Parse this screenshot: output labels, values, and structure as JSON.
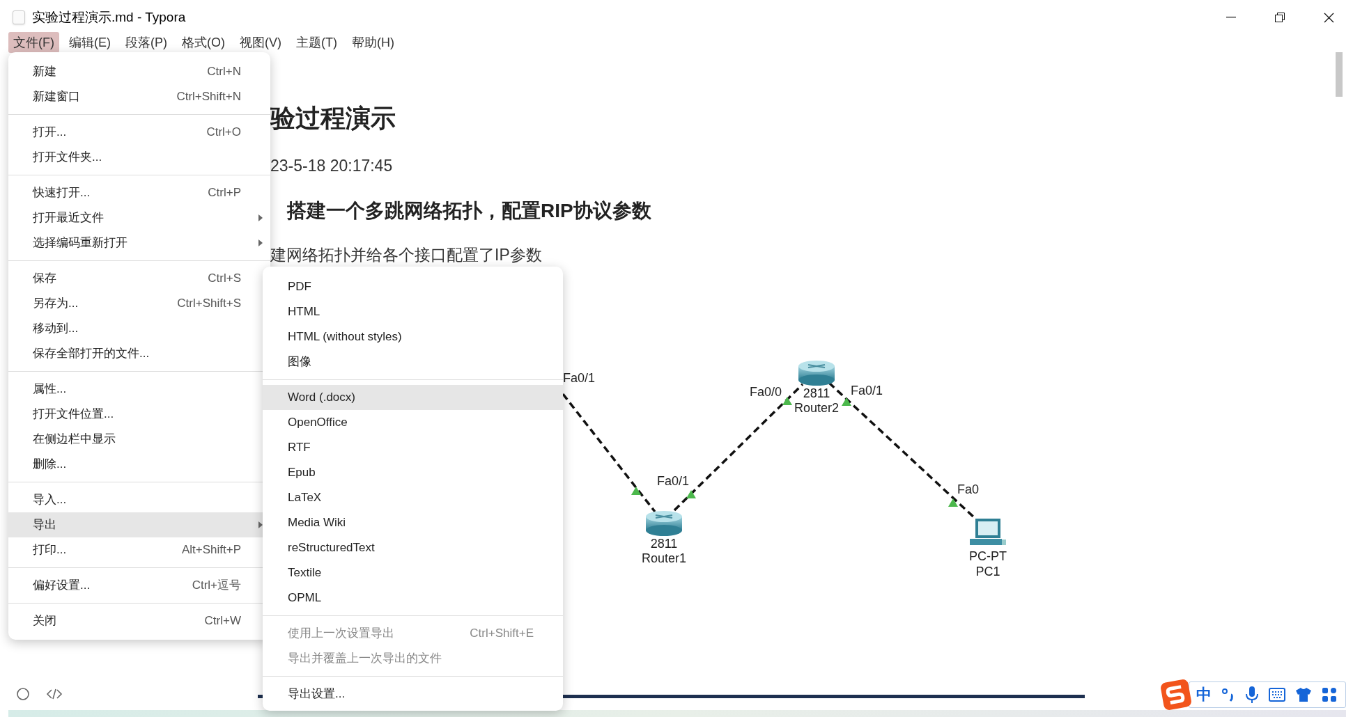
{
  "window": {
    "title": "实验过程演示.md - Typora"
  },
  "menu_bar": [
    {
      "label": "文件(F)",
      "selected": true
    },
    {
      "label": "编辑(E)",
      "selected": false
    },
    {
      "label": "段落(P)",
      "selected": false
    },
    {
      "label": "格式(O)",
      "selected": false
    },
    {
      "label": "视图(V)",
      "selected": false
    },
    {
      "label": "主题(T)",
      "selected": false
    },
    {
      "label": "帮助(H)",
      "selected": false
    }
  ],
  "file_menu": [
    [
      {
        "label": "新建",
        "shortcut": "Ctrl+N",
        "submenu": false,
        "selected": false
      },
      {
        "label": "新建窗口",
        "shortcut": "Ctrl+Shift+N",
        "submenu": false,
        "selected": false
      }
    ],
    [
      {
        "label": "打开...",
        "shortcut": "Ctrl+O",
        "submenu": false,
        "selected": false
      },
      {
        "label": "打开文件夹...",
        "submenu": false,
        "selected": false
      }
    ],
    [
      {
        "label": "快速打开...",
        "shortcut": "Ctrl+P",
        "submenu": false,
        "selected": false
      },
      {
        "label": "打开最近文件",
        "submenu": true,
        "selected": false
      },
      {
        "label": "选择编码重新打开",
        "submenu": true,
        "selected": false
      }
    ],
    [
      {
        "label": "保存",
        "shortcut": "Ctrl+S",
        "submenu": false,
        "selected": false
      },
      {
        "label": "另存为...",
        "shortcut": "Ctrl+Shift+S",
        "submenu": false,
        "selected": false
      },
      {
        "label": "移动到...",
        "submenu": false,
        "selected": false
      },
      {
        "label": "保存全部打开的文件...",
        "submenu": false,
        "selected": false
      }
    ],
    [
      {
        "label": "属性...",
        "submenu": false,
        "selected": false
      },
      {
        "label": "打开文件位置...",
        "submenu": false,
        "selected": false
      },
      {
        "label": "在侧边栏中显示",
        "submenu": false,
        "selected": false
      },
      {
        "label": "删除...",
        "submenu": false,
        "selected": false
      }
    ],
    [
      {
        "label": "导入...",
        "submenu": false,
        "selected": false
      },
      {
        "label": "导出",
        "submenu": true,
        "selected": true
      },
      {
        "label": "打印...",
        "shortcut": "Alt+Shift+P",
        "submenu": false,
        "selected": false
      }
    ],
    [
      {
        "label": "偏好设置...",
        "shortcut": "Ctrl+逗号",
        "submenu": false,
        "selected": false
      }
    ],
    [
      {
        "label": "关闭",
        "shortcut": "Ctrl+W",
        "submenu": false,
        "selected": false
      }
    ]
  ],
  "export_menu": [
    [
      {
        "label": "PDF",
        "selected": false,
        "disabled": false
      },
      {
        "label": "HTML",
        "selected": false,
        "disabled": false
      },
      {
        "label": "HTML (without styles)",
        "selected": false,
        "disabled": false
      },
      {
        "label": "图像",
        "selected": false,
        "disabled": false
      }
    ],
    [
      {
        "label": "Word (.docx)",
        "selected": true,
        "disabled": false
      },
      {
        "label": "OpenOffice",
        "selected": false,
        "disabled": false
      },
      {
        "label": "RTF",
        "selected": false,
        "disabled": false
      },
      {
        "label": "Epub",
        "selected": false,
        "disabled": false
      },
      {
        "label": "LaTeX",
        "selected": false,
        "disabled": false
      },
      {
        "label": "Media Wiki",
        "selected": false,
        "disabled": false
      },
      {
        "label": "reStructuredText",
        "selected": false,
        "disabled": false
      },
      {
        "label": "Textile",
        "selected": false,
        "disabled": false
      },
      {
        "label": "OPML",
        "selected": false,
        "disabled": false
      }
    ],
    [
      {
        "label": "使用上一次设置导出",
        "shortcut": "Ctrl+Shift+E",
        "selected": false,
        "disabled": true
      },
      {
        "label": "导出并覆盖上一次导出的文件",
        "selected": false,
        "disabled": true
      }
    ],
    [
      {
        "label": "导出设置...",
        "selected": false,
        "disabled": false
      }
    ]
  ],
  "document": {
    "heading": "验过程演示",
    "date": "23-5-18 20:17:45",
    "section_heading": "搭建一个多跳网络拓扑，配置RIP协议参数",
    "paragraph": "建网络拓扑并给各个接口配置了IP参数",
    "diagram": {
      "devices": [
        {
          "kind": "router",
          "model": "2811",
          "name": "Router1"
        },
        {
          "kind": "router",
          "model": "2811",
          "name": "Router2"
        },
        {
          "kind": "pc",
          "model": "PC-PT",
          "name": "PC1"
        }
      ],
      "port_labels": [
        "Fa0/1",
        "Fa0/1",
        "Fa0/0",
        "Fa0/1",
        "Fa0"
      ]
    }
  },
  "input_method": {
    "mode": "中"
  }
}
